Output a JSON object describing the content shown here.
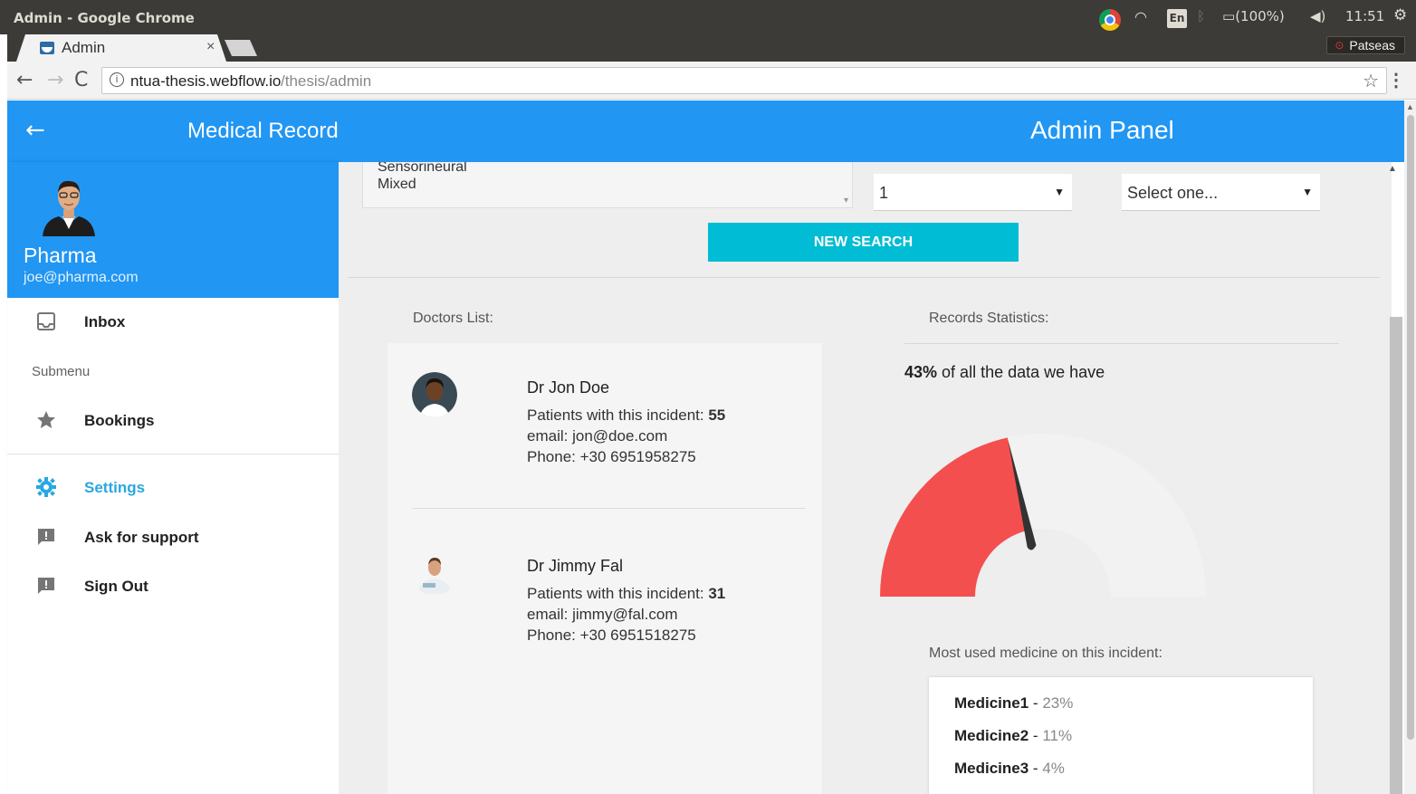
{
  "os": {
    "window_title": "Admin - Google Chrome",
    "lang_indicator": "En",
    "battery": "(100%)",
    "clock": "11:51"
  },
  "browser": {
    "tab_title": "Admin",
    "tab_close": "×",
    "profile_name": "Patseas",
    "url_host": "ntua-thesis.webflow.io",
    "url_path": "/thesis/admin"
  },
  "header": {
    "back_icon": "arrow-left-icon",
    "title": "Medical Record",
    "panel_title": "Admin Panel"
  },
  "sidebar": {
    "profile": {
      "name": "Pharma",
      "email": "joe@pharma.com"
    },
    "items": [
      {
        "label": "Inbox",
        "icon": "inbox-icon"
      },
      {
        "label": "Bookings",
        "icon": "star-icon"
      },
      {
        "label": "Settings",
        "icon": "gear-icon"
      },
      {
        "label": "Ask for support",
        "icon": "feedback-icon"
      },
      {
        "label": "Sign Out",
        "icon": "feedback-icon"
      }
    ],
    "submenu_label": "Submenu"
  },
  "filters": {
    "hearing_loss_options": [
      "Sensorineural",
      "Mixed"
    ],
    "number_select": "1",
    "other_select": "Select one...",
    "search_button": "NEW SEARCH"
  },
  "doctors": {
    "heading": "Doctors List:",
    "list": [
      {
        "name": "Dr Jon Doe",
        "patients_label": "Patients with this incident:",
        "patients": "55",
        "email_label": "email:",
        "email": "jon@doe.com",
        "phone_label": "Phone:",
        "phone": "+30 6951958275"
      },
      {
        "name": "Dr Jimmy Fal",
        "patients_label": "Patients with this incident:",
        "patients": "31",
        "email_label": "email:",
        "email": "jimmy@fal.com",
        "phone_label": "Phone:",
        "phone": "+30 6951518275"
      }
    ]
  },
  "stats": {
    "heading": "Records Statistics:",
    "percent": "43%",
    "percent_text": "of all the data we have",
    "gauge_value": 0.43,
    "gauge_color": "#f44f4f",
    "gauge_bg": "#f2f2f2",
    "medicine_heading": "Most used medicine on this incident:",
    "medicines": [
      {
        "name": "Medicine1",
        "pct": "23%"
      },
      {
        "name": "Medicine2",
        "pct": "11%"
      },
      {
        "name": "Medicine3",
        "pct": "4%"
      }
    ]
  },
  "colors": {
    "primary": "#2196f3",
    "accent": "#00bcd4",
    "settings": "#29a7e0"
  }
}
